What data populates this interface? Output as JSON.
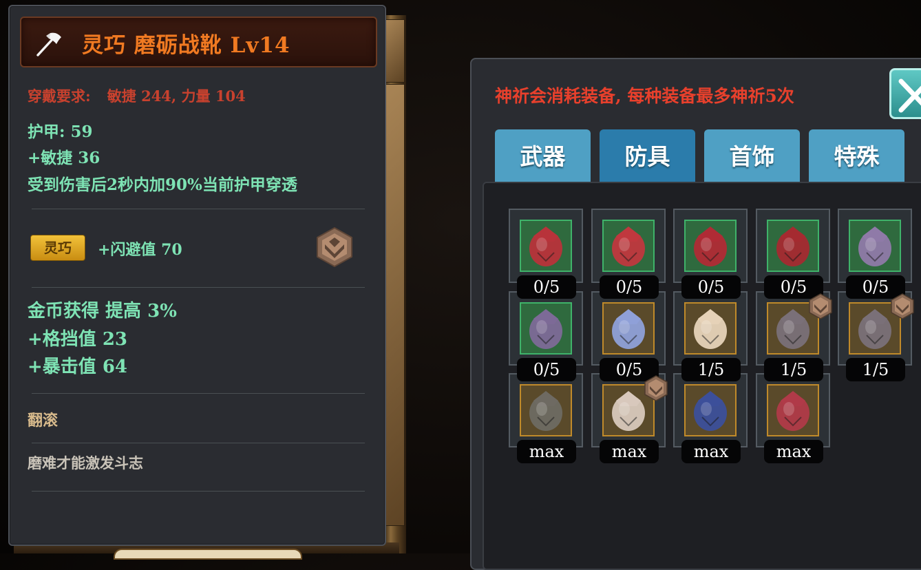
{
  "item": {
    "title": "灵巧 磨砺战靴 Lv14",
    "requirement_label": "穿戴要求:",
    "requirement_value": "敏捷 244, 力量 104",
    "stats": [
      "护甲: 59",
      "+敏捷 36",
      "受到伤害后2秒内加90%当前护甲穿透"
    ],
    "affix_badge": "灵巧",
    "affix_stat": "+闪避值 70",
    "bonus_stats": [
      "金币获得 提高 3%",
      "+格挡值 23",
      "+暴击值 64"
    ],
    "skill": "翻滚",
    "flavor": "磨难才能激发斗志"
  },
  "pray": {
    "notice": "神祈会消耗装备, 每种装备最多神祈5次",
    "tabs": [
      "武器",
      "防具",
      "首饰",
      "特殊"
    ],
    "active_tab": "防具",
    "slots": [
      {
        "count": "0/5",
        "frame": "green",
        "art": "red-helmet",
        "color": "#b8333a"
      },
      {
        "count": "0/5",
        "frame": "green",
        "art": "red-chest",
        "color": "#c0383e"
      },
      {
        "count": "0/5",
        "frame": "green",
        "art": "red-gauntlet",
        "color": "#b02b35"
      },
      {
        "count": "0/5",
        "frame": "green",
        "art": "red-boots",
        "color": "#a52a30"
      },
      {
        "count": "0/5",
        "frame": "green",
        "art": "purple-helmet",
        "color": "#8f7aa8"
      },
      {
        "count": "0/5",
        "frame": "green",
        "art": "purple-gauntlet",
        "color": "#7d6a97"
      },
      {
        "count": "0/5",
        "frame": "gold",
        "art": "blue-gauntlet",
        "color": "#8fa0d8"
      },
      {
        "count": "1/5",
        "frame": "gold",
        "art": "gold-chest",
        "color": "#e6d2b8"
      },
      {
        "count": "1/5",
        "frame": "gold",
        "art": "steel-boots",
        "color": "#7a7078",
        "rank_icon": true
      },
      {
        "count": "1/5",
        "frame": "gold",
        "art": "steel-boots",
        "color": "#7a7078",
        "rank_icon": true
      },
      {
        "count": "max",
        "frame": "gold",
        "art": "grey-chest",
        "color": "#6e6a62"
      },
      {
        "count": "max",
        "frame": "gold",
        "art": "bone-chest",
        "color": "#d8c8bc",
        "rank_icon": true
      },
      {
        "count": "max",
        "frame": "gold",
        "art": "blue-boots",
        "color": "#3c4f9a"
      },
      {
        "count": "max",
        "frame": "gold",
        "art": "crimson-legs",
        "color": "#b03a48"
      }
    ]
  },
  "colors": {
    "title": "#f07a22",
    "requirement": "#c8412e",
    "stat": "#7ee3b4",
    "notice": "#e8402c",
    "tab": "#4fa0c4",
    "tab_active": "#2b7cab"
  }
}
